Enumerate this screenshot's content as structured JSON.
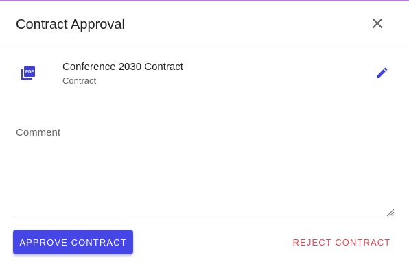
{
  "dialog": {
    "title": "Contract Approval",
    "close_icon": "close-icon"
  },
  "file": {
    "icon": "pdf-file-icon",
    "name": "Conference 2030 Contract",
    "type": "Contract",
    "edit_icon": "pencil-icon"
  },
  "comment": {
    "label": "Comment",
    "value": ""
  },
  "actions": {
    "approve_label": "APPROVE CONTRACT",
    "reject_label": "REJECT CONTRACT"
  },
  "colors": {
    "accent_bar": "#b47ae0",
    "primary": "#4646e6",
    "danger": "#f0444f",
    "icon": "#3f3fd8"
  }
}
